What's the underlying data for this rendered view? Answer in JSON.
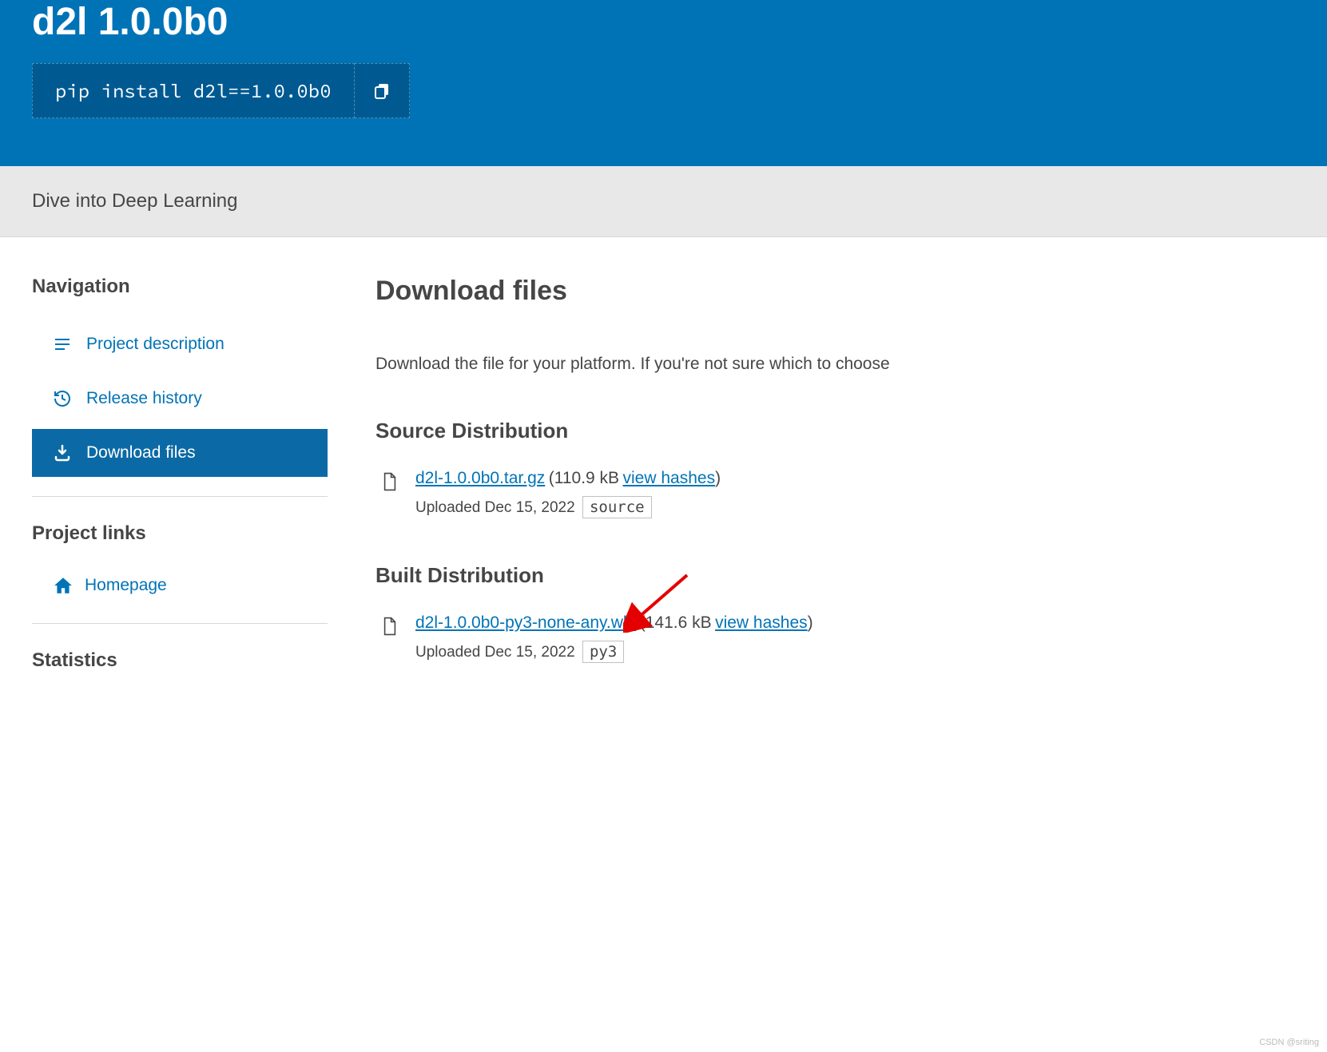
{
  "header": {
    "title": "d2l 1.0.0b0",
    "install_command": "pip install d2l==1.0.0b0"
  },
  "summary": "Dive into Deep Learning",
  "sidebar": {
    "navigation_heading": "Navigation",
    "nav_items": [
      {
        "label": "Project description"
      },
      {
        "label": "Release history"
      },
      {
        "label": "Download files"
      }
    ],
    "project_links_heading": "Project links",
    "project_links": [
      {
        "label": "Homepage"
      }
    ],
    "statistics_heading": "Statistics"
  },
  "main": {
    "heading": "Download files",
    "intro": "Download the file for your platform. If you're not sure which to choose",
    "source_heading": "Source Distribution",
    "built_heading": "Built Distribution",
    "files": [
      {
        "name": "d2l-1.0.0b0.tar.gz",
        "size": "(110.9 kB",
        "view_hashes": "view hashes",
        "close_paren": ")",
        "uploaded": "Uploaded Dec 15, 2022",
        "tag": "source"
      },
      {
        "name": "d2l-1.0.0b0-py3-none-any.whl",
        "size": "(141.6 kB",
        "view_hashes": "view hashes",
        "close_paren": ")",
        "uploaded": "Uploaded Dec 15, 2022",
        "tag": "py3"
      }
    ]
  },
  "watermark": "CSDN @sriting"
}
